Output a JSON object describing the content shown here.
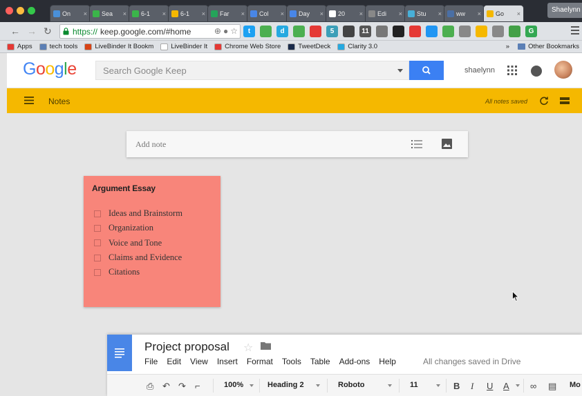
{
  "browser": {
    "tabs": [
      {
        "label": "On",
        "color": "#4a90d9"
      },
      {
        "label": "Sea",
        "color": "#3bb54a"
      },
      {
        "label": "6-1",
        "color": "#3bb54a"
      },
      {
        "label": "6-1",
        "color": "#f5b800"
      },
      {
        "label": "Far",
        "color": "#25a35a"
      },
      {
        "label": "Col",
        "color": "#4986e7"
      },
      {
        "label": "Day",
        "color": "#4986e7"
      },
      {
        "label": "20",
        "color": "#ffffff"
      },
      {
        "label": "Edi",
        "color": "#888888"
      },
      {
        "label": "Stu",
        "color": "#48b0d8"
      },
      {
        "label": "ww",
        "color": "#4a6fa5"
      },
      {
        "label": "Go",
        "color": "#f5b800"
      }
    ],
    "tab_close": "×",
    "profile": "Shaelynn",
    "url_scheme": "https://",
    "url_rest": "keep.google.com/#home",
    "extensions": [
      {
        "label": "t",
        "color": "#1da1f2"
      },
      {
        "label": "",
        "color": "#4caf50"
      },
      {
        "label": "d",
        "color": "#26a9e0"
      },
      {
        "label": "",
        "color": "#4caf50"
      },
      {
        "label": "",
        "color": "#e53935"
      },
      {
        "label": "5",
        "color": "#3c9fb8"
      },
      {
        "label": "",
        "color": "#444444"
      },
      {
        "label": "11",
        "color": "#555555"
      },
      {
        "label": "",
        "color": "#777777"
      },
      {
        "label": "",
        "color": "#222222"
      },
      {
        "label": "",
        "color": "#e53935"
      },
      {
        "label": "",
        "color": "#2196f3"
      },
      {
        "label": "",
        "color": "#4caf50"
      },
      {
        "label": "",
        "color": "#888888"
      },
      {
        "label": "",
        "color": "#f5b800"
      },
      {
        "label": "",
        "color": "#888888"
      },
      {
        "label": "",
        "color": "#43a047"
      },
      {
        "label": "G",
        "color": "#34a853"
      }
    ]
  },
  "bookmarks": {
    "items": [
      {
        "label": "Apps",
        "color": "#e53935"
      },
      {
        "label": "tech tools",
        "color": "#5b7fb5"
      },
      {
        "label": "LiveBinder It Bookm",
        "color": "#d84315"
      },
      {
        "label": "LiveBinder It",
        "color": "#ffffff"
      },
      {
        "label": "Chrome Web Store",
        "color": "#e53935"
      },
      {
        "label": "TweetDeck",
        "color": "#1a2a4a"
      },
      {
        "label": "Clarity 3.0",
        "color": "#26a9e0"
      }
    ],
    "overflow": "»",
    "other": "Other Bookmarks"
  },
  "keep": {
    "logo": "Google",
    "search_placeholder": "Search Google Keep",
    "user": "shaelynn",
    "section": "Notes",
    "saved_status": "All notes saved",
    "add_note_placeholder": "Add note",
    "note": {
      "title": "Argument Essay",
      "color": "#f8857a",
      "items": [
        "Ideas and Brainstorm",
        "Organization",
        "Voice and Tone",
        "Claims and Evidence",
        "Citations"
      ]
    }
  },
  "docs": {
    "title": "Project proposal",
    "menu": [
      "File",
      "Edit",
      "View",
      "Insert",
      "Format",
      "Tools",
      "Table",
      "Add-ons",
      "Help"
    ],
    "saved": "All changes saved in Drive",
    "zoom": "100%",
    "style": "Heading 2",
    "font": "Roboto",
    "size": "11",
    "more": "Mo"
  }
}
